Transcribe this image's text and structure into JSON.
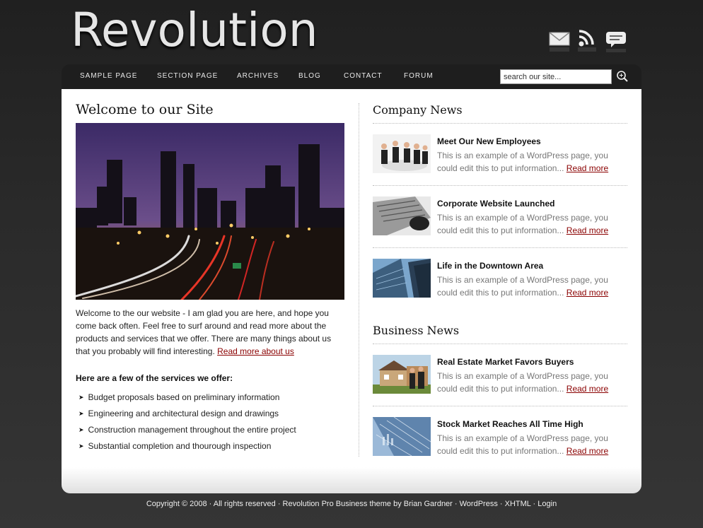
{
  "site": {
    "title": "Revolution"
  },
  "header_icons": [
    "mail-icon",
    "rss-icon",
    "chat-icon"
  ],
  "nav": {
    "items": [
      "SAMPLE PAGE",
      "SECTION PAGE",
      "ARCHIVES",
      "BLOG",
      "CONTACT",
      "FORUM"
    ],
    "search_value": "search our site..."
  },
  "main": {
    "title": "Welcome to our Site",
    "intro": "Welcome to the our website - I am glad you are here, and hope you come back often. Feel free to surf around and read more about the products and services that we offer. There are many things about us that you probably will find interesting.",
    "intro_link": "Read more about us",
    "services_heading": "Here are a few of the services we offer:",
    "services": [
      "Budget proposals based on preliminary information",
      "Engineering and architectural design and drawings",
      "Construction management throughout the entire project",
      "Substantial completion and thourough inspection"
    ]
  },
  "company_news": {
    "title": "Company News",
    "items": [
      {
        "title": "Meet Our New Employees",
        "text": "This is an example of a WordPress page, you could edit this to put information...",
        "link": "Read more"
      },
      {
        "title": "Corporate Website Launched",
        "text": "This is an example of a WordPress page, you could edit this to put information...",
        "link": "Read more"
      },
      {
        "title": "Life in the Downtown Area",
        "text": "This is an example of a WordPress page, you could edit this to put information...",
        "link": "Read more"
      }
    ]
  },
  "business_news": {
    "title": "Business News",
    "items": [
      {
        "title": "Real Estate Market Favors Buyers",
        "text": "This is an example of a WordPress page, you could edit this to put information...",
        "link": "Read more"
      },
      {
        "title": "Stock Market Reaches All Time High",
        "text": "This is an example of a WordPress page, you could edit this to put information...",
        "link": "Read more"
      }
    ]
  },
  "footer": {
    "copyright": "Copyright © 2008 · All rights reserved · Revolution Pro Business theme by Brian Gardner · ",
    "links": [
      "WordPress",
      "XHTML",
      "Login"
    ],
    "sep": " · "
  },
  "colors": {
    "link": "#8a0000",
    "nav_bg": "#1e1e1e",
    "page_bg": "#2a2a2a"
  }
}
